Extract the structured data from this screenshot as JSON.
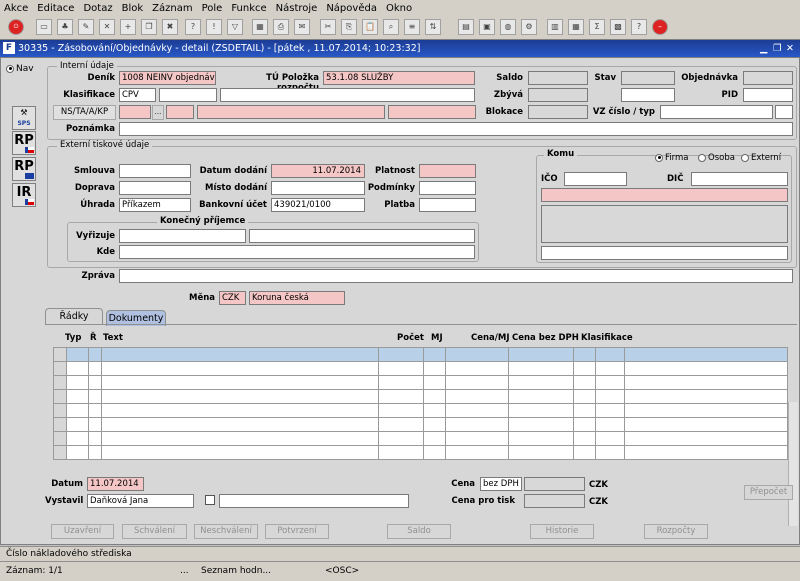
{
  "menu": [
    "Akce",
    "Editace",
    "Dotaz",
    "Blok",
    "Záznam",
    "Pole",
    "Funkce",
    "Nástroje",
    "Nápověda",
    "Okno"
  ],
  "window_title": "30335 - Zásobování/Objednávky - detail (ZSDETAIL) - [pátek , 11.07.2014; 10:23:32]",
  "nav_label": "Nav",
  "sidebar": {
    "sps": "SPS",
    "rp1": "RP",
    "rp2": "RP",
    "ir": "IR"
  },
  "interni": {
    "group_title": "Interní údaje",
    "denik_label": "Deník",
    "denik_value": "1008 NEINV objednávky",
    "tu_label": "TÚ Položka rozpočtu",
    "tu_value": "53.1.08 SLUŽBY",
    "saldo_label": "Saldo",
    "stav_label": "Stav",
    "objednavka_label": "Objednávka",
    "klasifikace_label": "Klasifikace",
    "klasifikace_value": "CPV",
    "zbyva_label": "Zbývá",
    "pid_label": "PID",
    "nsta_button": "NS/TA/A/KP",
    "lov_button": "...",
    "blokace_label": "Blokace",
    "vz_label": "VZ číslo / typ",
    "poznamka_label": "Poznámka"
  },
  "externi": {
    "group_title": "Externí tiskové údaje",
    "smlouva_label": "Smlouva",
    "datum_dodani_label": "Datum dodání",
    "datum_dodani_value": "11.07.2014",
    "platnost_label": "Platnost",
    "doprava_label": "Doprava",
    "misto_label": "Místo dodání",
    "podminky_label": "Podmínky",
    "uhrada_label": "Úhrada",
    "uhrada_value": "Příkazem",
    "ucet_label": "Bankovní účet",
    "ucet_value": "439021/0100",
    "platba_label": "Platba",
    "konecny_title": "Konečný příjemce",
    "vyrizuje_label": "Vyřizuje",
    "kde_label": "Kde",
    "zprava_label": "Zpráva",
    "mena_label": "Měna",
    "mena_code": "CZK",
    "mena_name": "Koruna česká"
  },
  "komu": {
    "title": "Komu",
    "firma": "Firma",
    "osoba": "Osoba",
    "externi": "Externí",
    "ico_label": "IČO",
    "dic_label": "DIČ"
  },
  "tabs": [
    "Řádky",
    "Dokumenty"
  ],
  "grid": {
    "headers": [
      "Typ",
      "Ř",
      "Text",
      "Počet",
      "MJ",
      "Cena/MJ",
      "Cena bez DPH",
      "Klasifikace"
    ]
  },
  "footer": {
    "datum_label": "Datum",
    "datum_value": "11.07.2014",
    "vystavil_label": "Vystavil",
    "vystavil_value": "Daňková Jana",
    "cena_label": "Cena",
    "cena_type": "bez DPH",
    "cena_cur": "CZK",
    "cena_tisk_label": "Cena pro tisk",
    "cena_tisk_cur": "CZK",
    "prepocet_button": "Přepočet"
  },
  "buttons": [
    "Uzavření",
    "Schválení",
    "Neschválení",
    "Potvrzení",
    "Saldo",
    "Historie",
    "Rozpočty"
  ],
  "status": {
    "hint": "Číslo nákladového střediska",
    "record": "Záznam: 1/1",
    "dots": "...",
    "list": "Seznam hodn...",
    "osc": "<OSC>"
  }
}
